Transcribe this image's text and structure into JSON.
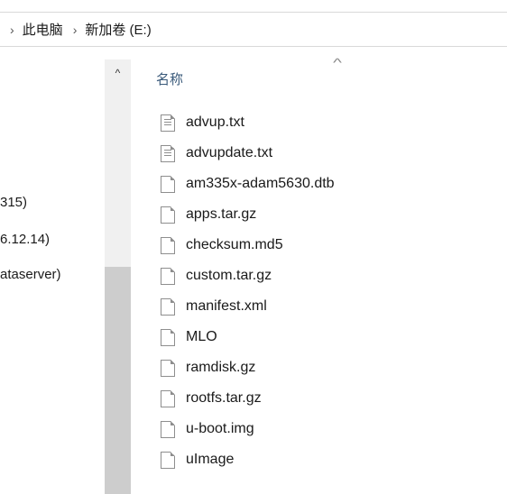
{
  "breadcrumb": {
    "sep": "›",
    "items": [
      "此电脑",
      "新加卷 (E:)"
    ]
  },
  "navigation": {
    "items": [
      {
        "label": "315)"
      },
      {
        "label": "6.12.14)"
      },
      {
        "label": "ataserver)"
      }
    ],
    "scroll_up_glyph": "^"
  },
  "filelist": {
    "sort_caret": "^",
    "column_name": "名称",
    "files": [
      {
        "name": "advup.txt",
        "icon": "text-document-icon"
      },
      {
        "name": "advupdate.txt",
        "icon": "text-document-icon"
      },
      {
        "name": "am335x-adam5630.dtb",
        "icon": "blank-file-icon"
      },
      {
        "name": "apps.tar.gz",
        "icon": "blank-file-icon"
      },
      {
        "name": "checksum.md5",
        "icon": "blank-file-icon"
      },
      {
        "name": "custom.tar.gz",
        "icon": "blank-file-icon"
      },
      {
        "name": "manifest.xml",
        "icon": "blank-file-icon"
      },
      {
        "name": "MLO",
        "icon": "blank-file-icon"
      },
      {
        "name": "ramdisk.gz",
        "icon": "blank-file-icon"
      },
      {
        "name": "rootfs.tar.gz",
        "icon": "blank-file-icon"
      },
      {
        "name": "u-boot.img",
        "icon": "blank-file-icon"
      },
      {
        "name": "uImage",
        "icon": "blank-file-icon"
      }
    ]
  }
}
